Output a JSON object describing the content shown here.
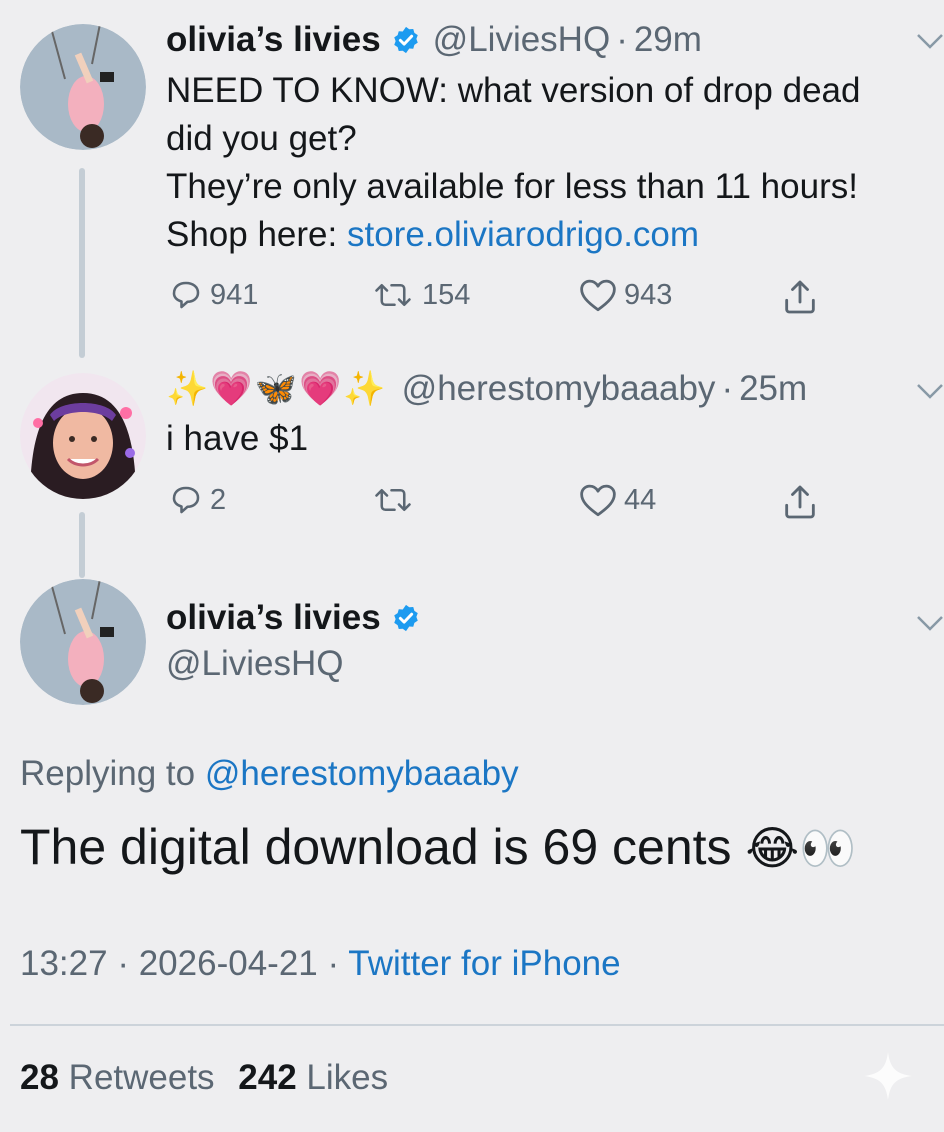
{
  "tweets": [
    {
      "name": "olivia’s livies",
      "handle": "@LiviesHQ",
      "separator": "·",
      "time": "29m",
      "text_lines": [
        "NEED TO KNOW: what version of drop dead",
        "did you get?",
        "They’re only available for less than 11 hours!"
      ],
      "shop_prefix": "Shop here: ",
      "shop_link": "store.oliviarodrigo.com",
      "replies": "941",
      "retweets": "154",
      "likes": "943"
    },
    {
      "name_emoji": "✨💗🦋💗✨",
      "handle": "@herestomybaaaby",
      "separator": "·",
      "time": "25m",
      "text": "i have $1",
      "replies": "2",
      "retweets": "",
      "likes": "44"
    }
  ],
  "main_tweet": {
    "name": "olivia’s livies",
    "handle": "@LiviesHQ",
    "replying_prefix": "Replying to ",
    "replying_handle": "@herestomybaaaby",
    "text": "The digital download is 69 cents ",
    "text_emoji": "😂👀",
    "time": "13:27",
    "date": "2026-04-21",
    "separator": "·",
    "source": "Twitter for iPhone",
    "retweet_count": "28",
    "retweet_label": " Retweets",
    "like_count": "242",
    "like_label": " Likes"
  },
  "icons": {
    "verified": "verified-badge-icon",
    "reply": "reply-icon",
    "retweet": "retweet-icon",
    "like": "heart-icon",
    "share": "share-icon",
    "chevron": "chevron-down-icon"
  },
  "colors": {
    "background": "#eeeef0",
    "text": "#14171a",
    "secondary": "#5b6773",
    "link": "#1b76c4",
    "verified": "#1d9bf0"
  }
}
